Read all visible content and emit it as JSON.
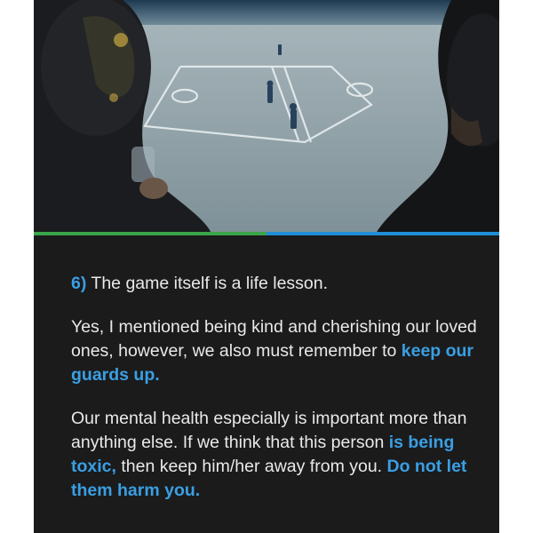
{
  "slide": {
    "progress": 0.5,
    "colors": {
      "background": "#1b1b1c",
      "accent": "#3a9fe3",
      "progress_done": "#3aa54a",
      "progress_rest": "#1f8ed6"
    },
    "heading": {
      "number": "6)",
      "text": "The game itself is a life lesson."
    },
    "paragraph1": {
      "text1": "Yes, I mentioned being kind and cherishing our loved ones, however, we also must remember to ",
      "highlight1": "keep our guards up."
    },
    "paragraph2": {
      "text1": "Our mental health especially is important more than anything else. If we think that this person ",
      "highlight1": "is being toxic,",
      "text2": " then keep him/her away from you. ",
      "highlight2": "Do not let them harm you."
    }
  }
}
